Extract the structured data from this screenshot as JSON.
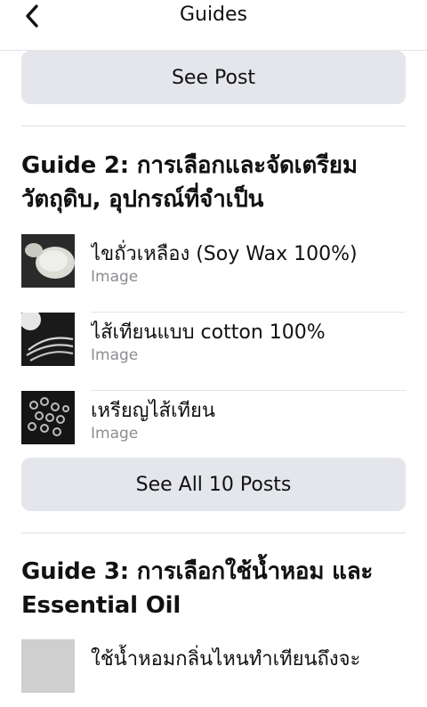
{
  "header": {
    "title": "Guides"
  },
  "buttons": {
    "see_post": "See Post",
    "see_all": "See All 10 Posts"
  },
  "guide2": {
    "title_line1": "Guide 2:  การเลือกและจัดเตรียม",
    "title_line2": "วัตถุดิบ, อุปกรณ์ที่จำเป็น",
    "items": [
      {
        "title": "ไขถั่วเหลือง (Soy Wax 100%)",
        "subtitle": "Image"
      },
      {
        "title": "ไส้เทียนแบบ cotton 100%",
        "subtitle": "Image"
      },
      {
        "title": "เหรียญไส้เทียน",
        "subtitle": "Image"
      }
    ]
  },
  "guide3": {
    "title_line1": "Guide 3: การเลือกใช้น้ำหอม และ",
    "title_line2": "Essential Oil",
    "partial_item_title": "ใช้น้ำหอมกลิ่นไหนทำเทียนถึงจะ"
  },
  "colors": {
    "button_bg": "#e4e6eb",
    "subtitle": "#8a8d91",
    "divider": "#dadde1"
  }
}
